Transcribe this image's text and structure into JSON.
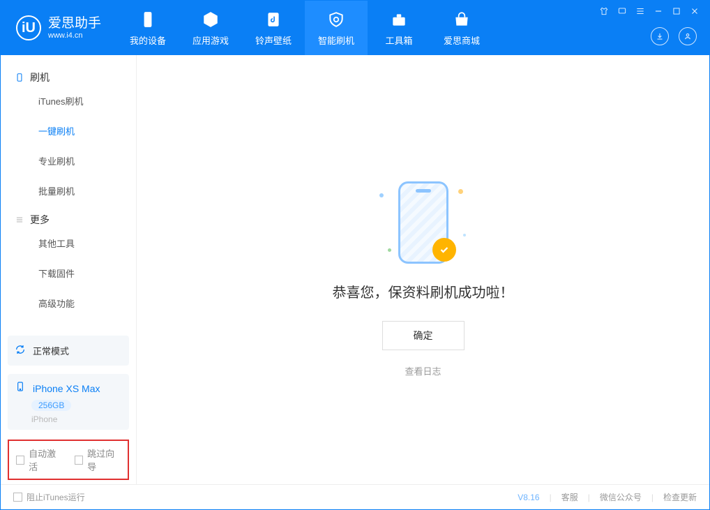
{
  "logo": {
    "title": "爱思助手",
    "sub": "www.i4.cn",
    "glyph": "iU"
  },
  "tabs": {
    "device": "我的设备",
    "apps": "应用游戏",
    "ring": "铃声壁纸",
    "flash": "智能刷机",
    "tools": "工具箱",
    "store": "爱思商城"
  },
  "sidebar": {
    "group_flash": "刷机",
    "items_flash": {
      "itunes": "iTunes刷机",
      "onekey": "一键刷机",
      "pro": "专业刷机",
      "batch": "批量刷机"
    },
    "group_more": "更多",
    "items_more": {
      "other": "其他工具",
      "firmware": "下载固件",
      "advanced": "高级功能"
    },
    "status": "正常模式",
    "device": {
      "name": "iPhone XS Max",
      "storage": "256GB",
      "type": "iPhone"
    },
    "check_auto": "自动激活",
    "check_skip": "跳过向导"
  },
  "main": {
    "success": "恭喜您，保资料刷机成功啦！",
    "ok": "确定",
    "viewlog": "查看日志"
  },
  "footer": {
    "block_itunes": "阻止iTunes运行",
    "version": "V8.16",
    "service": "客服",
    "wechat": "微信公众号",
    "update": "检查更新"
  }
}
